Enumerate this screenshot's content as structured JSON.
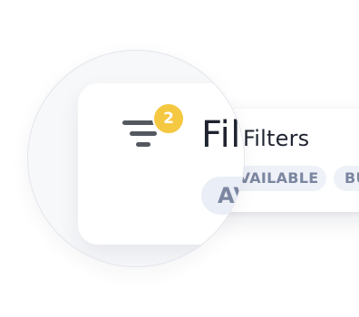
{
  "filters_panel": {
    "title": "Filters",
    "active_count": "2",
    "icon": "filter-icon",
    "chips": [
      {
        "label": "AVAILABLE"
      },
      {
        "label": "BU"
      }
    ]
  },
  "colors": {
    "badge": "#f5c842",
    "chip_background": "#eef1f7",
    "chip_text": "#7b86a0",
    "title_text": "#1f2430",
    "icon": "#54585f"
  }
}
